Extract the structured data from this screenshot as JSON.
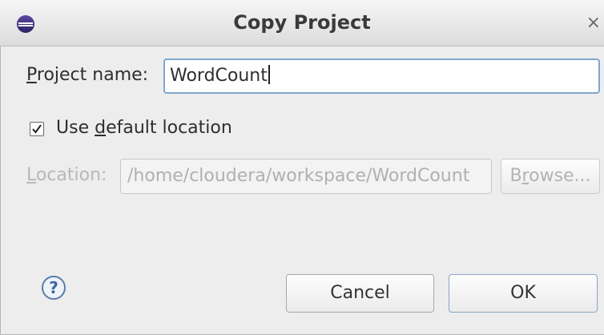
{
  "window": {
    "title": "Copy Project",
    "close_glyph": "×",
    "icon": "eclipse-icon"
  },
  "project_name": {
    "prefix_underlined": "P",
    "rest": "roject name:",
    "value": "WordCount"
  },
  "use_default": {
    "checked": true,
    "text_before": "Use ",
    "underlined": "d",
    "text_after": "efault location"
  },
  "location": {
    "underlined": "L",
    "rest": "ocation:",
    "value": "/home/cloudera/workspace/WordCount",
    "enabled": false
  },
  "browse": {
    "before": "B",
    "underlined": "r",
    "after": "owse...",
    "enabled": false
  },
  "help": {
    "glyph": "?",
    "icon": "help-icon"
  },
  "buttons": {
    "cancel": "Cancel",
    "ok": "OK"
  }
}
